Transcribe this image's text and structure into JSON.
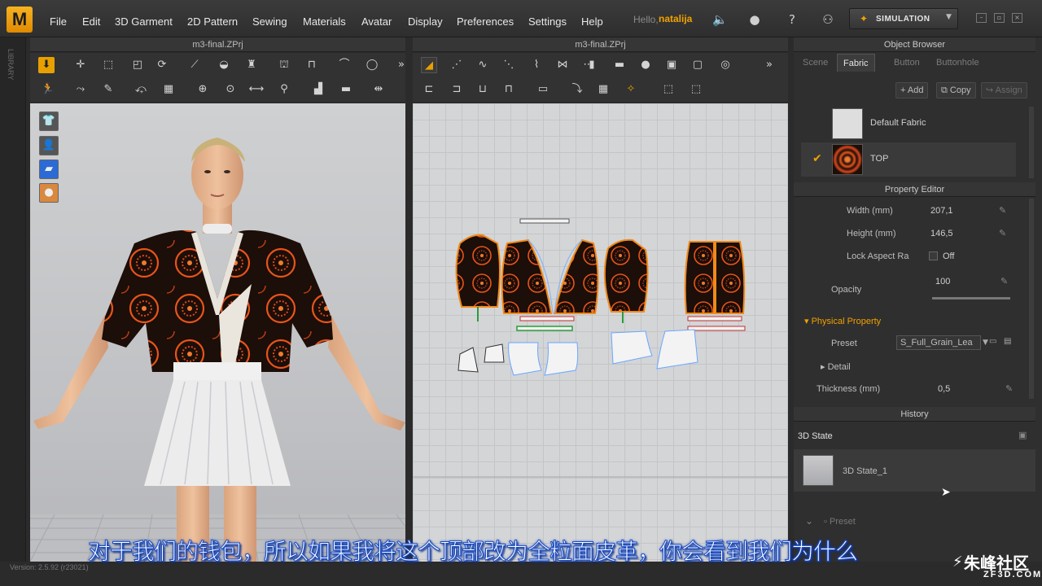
{
  "app": {
    "logo": "M",
    "hello": "Hello,",
    "user": "natalija",
    "simulation": "SIMULATION"
  },
  "menu": [
    "File",
    "Edit",
    "3D Garment",
    "2D Pattern",
    "Sewing",
    "Materials",
    "Avatar",
    "Display",
    "Preferences",
    "Settings",
    "Help"
  ],
  "library_label": "LIBRARY",
  "view3d": {
    "title": "m3-final.ZPrj"
  },
  "view2d": {
    "title": "m3-final.ZPrj"
  },
  "object_browser": {
    "title": "Object Browser",
    "tabs": [
      "Scene",
      "Fabric",
      "Button",
      "Buttonhole"
    ],
    "active_tab": "Fabric",
    "buttons": {
      "add": "Add",
      "copy": "Copy",
      "assign": "Assign"
    },
    "fabrics": [
      {
        "name": "Default Fabric",
        "selected": false
      },
      {
        "name": "TOP",
        "selected": true
      }
    ]
  },
  "property_editor": {
    "title": "Property Editor",
    "width_label": "Width (mm)",
    "width_value": "207,1",
    "height_label": "Height (mm)",
    "height_value": "146,5",
    "lock_label": "Lock Aspect Ra",
    "lock_value": "Off",
    "opacity_label": "Opacity",
    "opacity_value": "100",
    "physical_label": "Physical Property",
    "preset_label": "Preset",
    "preset_value": "S_Full_Grain_Lea",
    "detail_label": "Detail",
    "thickness_label": "Thickness (mm)",
    "thickness_value": "0,5"
  },
  "history": {
    "title": "History",
    "state_header": "3D State",
    "state_item": "3D State_1",
    "preset_label": "Preset"
  },
  "subtitle": "对于我们的钱包，所以如果我将这个顶部改为全粒面皮革，你会看到我们为什么",
  "version": "Version: 2.5.92    (r23021)",
  "watermark": {
    "name": "朱峰社区",
    "site": "ZF3D.COM"
  },
  "colors": {
    "accent": "#f2a100",
    "fabric_orange": "#e8541a",
    "fabric_dark": "#1c0e08"
  }
}
